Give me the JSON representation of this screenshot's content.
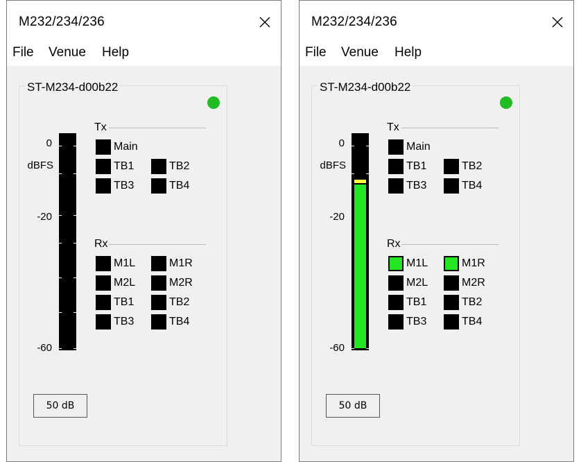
{
  "windows": [
    {
      "title": "M232/234/236",
      "menu": [
        "File",
        "Venue",
        "Help"
      ],
      "device": "ST-M234-d00b22",
      "scale": [
        "0",
        "dBFS",
        "-20",
        "-60"
      ],
      "tx": {
        "label": "Tx",
        "channels": [
          {
            "name": "Main",
            "active": false
          },
          {
            "name": "TB1",
            "active": false
          },
          {
            "name": "TB2",
            "active": false
          },
          {
            "name": "TB3",
            "active": false
          },
          {
            "name": "TB4",
            "active": false
          }
        ]
      },
      "rx": {
        "label": "Rx",
        "channels": [
          {
            "name": "M1L",
            "active": false
          },
          {
            "name": "M1R",
            "active": false
          },
          {
            "name": "M2L",
            "active": false
          },
          {
            "name": "M2R",
            "active": false
          },
          {
            "name": "TB1",
            "active": false
          },
          {
            "name": "TB2",
            "active": false
          },
          {
            "name": "TB3",
            "active": false
          },
          {
            "name": "TB4",
            "active": false
          }
        ]
      },
      "meter_level_fraction": 0,
      "meter_peak_fraction": 0,
      "gain": "50 dB",
      "status_color": "#1fbd1f"
    },
    {
      "title": "M232/234/236",
      "menu": [
        "File",
        "Venue",
        "Help"
      ],
      "device": "ST-M234-d00b22",
      "scale": [
        "0",
        "dBFS",
        "-20",
        "-60"
      ],
      "tx": {
        "label": "Tx",
        "channels": [
          {
            "name": "Main",
            "active": false
          },
          {
            "name": "TB1",
            "active": false
          },
          {
            "name": "TB2",
            "active": false
          },
          {
            "name": "TB3",
            "active": false
          },
          {
            "name": "TB4",
            "active": false
          }
        ]
      },
      "rx": {
        "label": "Rx",
        "channels": [
          {
            "name": "M1L",
            "active": true
          },
          {
            "name": "M1R",
            "active": true
          },
          {
            "name": "M2L",
            "active": false
          },
          {
            "name": "M2R",
            "active": false
          },
          {
            "name": "TB1",
            "active": false
          },
          {
            "name": "TB2",
            "active": false
          },
          {
            "name": "TB3",
            "active": false
          },
          {
            "name": "TB4",
            "active": false
          }
        ]
      },
      "meter_level_fraction": 0.77,
      "meter_peak_fraction": 0.79,
      "gain": "50 dB",
      "status_color": "#1fbd1f"
    }
  ]
}
